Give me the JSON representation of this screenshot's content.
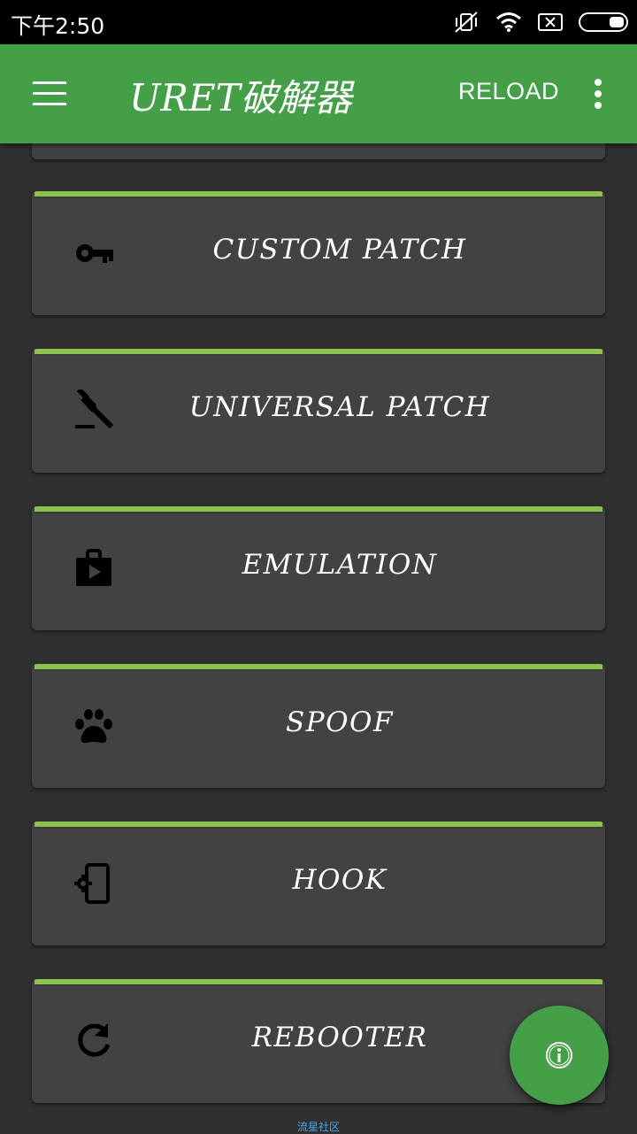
{
  "status_bar": {
    "time": "下午2:50",
    "icons": [
      "mute-vibrate-icon",
      "wifi-icon",
      "sim-error-icon",
      "battery-icon"
    ]
  },
  "app_bar": {
    "title": "URET破解器",
    "reload_label": "RELOAD",
    "background": "#43a047"
  },
  "cards": [
    {
      "label": "CUSTOM PATCH",
      "icon": "key-icon"
    },
    {
      "label": "UNIVERSAL PATCH",
      "icon": "gavel-icon"
    },
    {
      "label": "EMULATION",
      "icon": "shop-bag-play-icon"
    },
    {
      "label": "SPOOF",
      "icon": "paw-icon"
    },
    {
      "label": "HOOK",
      "icon": "settings-cell-icon"
    },
    {
      "label": "REBOOTER",
      "icon": "refresh-icon"
    }
  ],
  "accent_color": "#8bc34a",
  "card_color": "#424242",
  "fab": {
    "icon": "info-icon"
  },
  "watermark": "流星社区"
}
